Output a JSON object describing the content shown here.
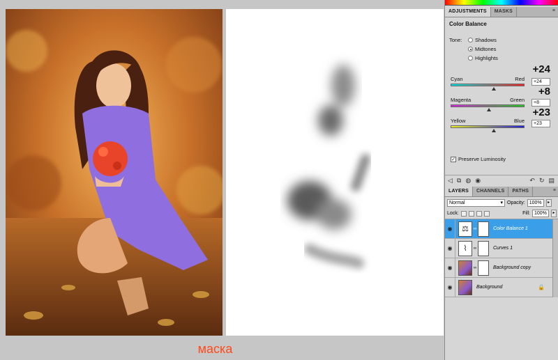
{
  "caption": "маска",
  "adjustments": {
    "tabs": [
      "ADJUSTMENTS",
      "MASKS"
    ],
    "title": "Color Balance",
    "tone_label": "Tone:",
    "tones": [
      "Shadows",
      "Midtones",
      "Highlights"
    ],
    "selected_tone": "Midtones",
    "sliders": [
      {
        "left": "Cyan",
        "right": "Red",
        "value": "+24",
        "input": "+24",
        "level": 24
      },
      {
        "left": "Magenta",
        "right": "Green",
        "value": "+8",
        "input": "+8",
        "level": 8
      },
      {
        "left": "Yellow",
        "right": "Blue",
        "value": "+23",
        "input": "+23",
        "level": 23
      }
    ],
    "preserve_luminosity": "Preserve Luminosity",
    "preserve_checked": true
  },
  "layers_panel": {
    "tabs": [
      "LAYERS",
      "CHANNELS",
      "PATHS"
    ],
    "blend_mode": "Normal",
    "opacity_label": "Opacity:",
    "opacity": "100%",
    "lock_label": "Lock:",
    "fill_label": "Fill:",
    "fill": "100%",
    "layers": [
      {
        "name": "Color Balance 1",
        "selected": true
      },
      {
        "name": "Curves 1",
        "selected": false
      },
      {
        "name": "Background copy",
        "selected": false
      },
      {
        "name": "Background",
        "selected": false
      }
    ]
  }
}
